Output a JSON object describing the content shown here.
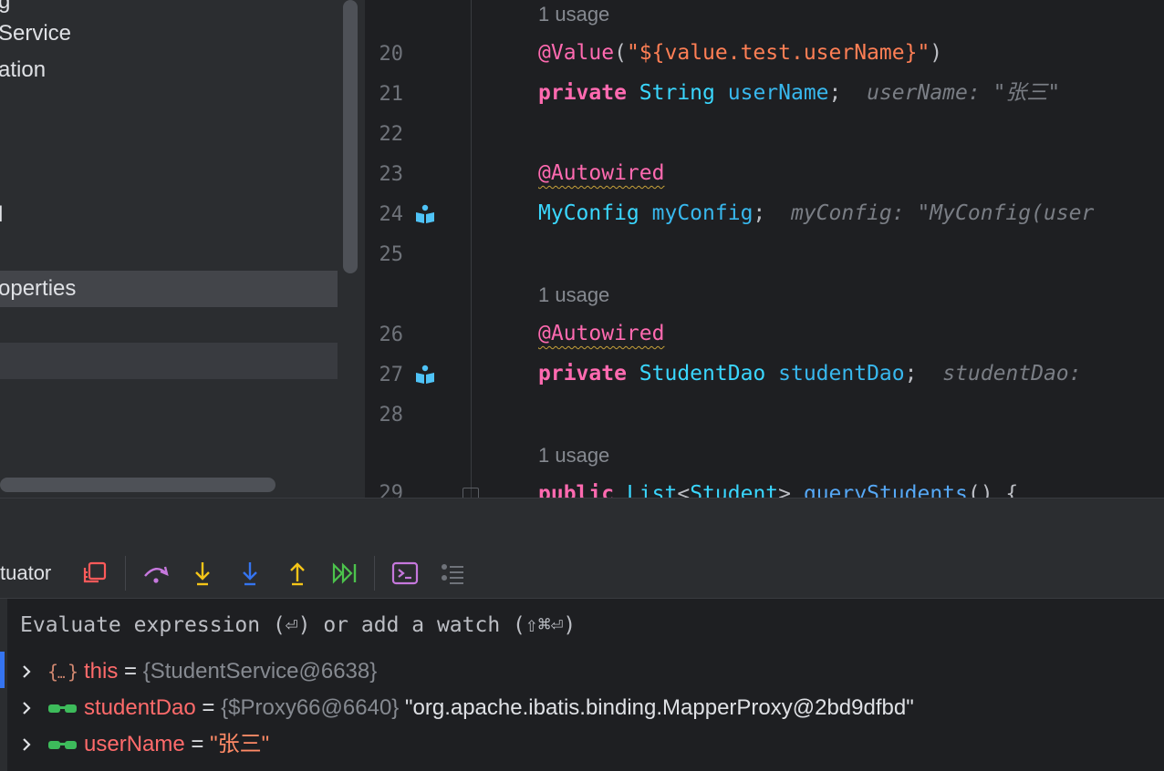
{
  "project_tree": {
    "rows": [
      {
        "text": "g",
        "state": "normal"
      },
      {
        "text": "Service",
        "state": "normal"
      },
      {
        "text": "ation",
        "state": "normal"
      },
      {
        "text": "l",
        "state": "normal"
      },
      {
        "text": "operties",
        "state": "selected"
      }
    ]
  },
  "editor": {
    "usage_hint": "1 usage",
    "line_numbers": {
      "l20": "20",
      "l21": "21",
      "l22": "22",
      "l23": "23",
      "l24": "24",
      "l25": "25",
      "l26": "26",
      "l27": "27",
      "l28": "28",
      "l29": "29"
    },
    "code": {
      "value_annotation": "@Value",
      "value_paren_open": "(",
      "value_string": "\"${value.test.userName}\"",
      "value_paren_close": ")",
      "kw_private": "private",
      "type_string": "String",
      "field_username": "userName",
      "semicolon": ";",
      "hint_username": "userName: \"张三\"",
      "autowired": "@Autowired",
      "type_myconfig": "MyConfig",
      "field_myconfig": "myConfig",
      "hint_myconfig": "myConfig: \"MyConfig(user",
      "type_studentdao": "StudentDao",
      "field_studentdao": "studentDao",
      "hint_studentdao": "studentDao:",
      "kw_public": "public",
      "type_list": "List",
      "generic_open": "<",
      "type_student": "Student",
      "generic_close": ">",
      "method_query": "queryStudents",
      "method_tail": "() {"
    },
    "gutter_icon": "bean-injection-icon"
  },
  "debugger": {
    "tab_label": "tuator",
    "toolbar_icons": [
      "restore-layout-icon",
      "step-over-icon",
      "step-into-icon",
      "force-step-into-icon",
      "step-out-icon",
      "run-to-cursor-icon",
      "evaluate-expression-icon",
      "threads-list-icon"
    ],
    "eval_placeholder": "Evaluate expression (⏎) or add a watch (⇧⌘⏎)",
    "variables": [
      {
        "icon": "object-icon",
        "name": "this",
        "equals": " = ",
        "address": "{StudentService@6638}",
        "value": ""
      },
      {
        "icon": "field-glasses-icon",
        "name": "studentDao",
        "equals": " = ",
        "address": "{$Proxy66@6640}",
        "value": " \"org.apache.ibatis.binding.MapperProxy@2bd9dfbd\""
      },
      {
        "icon": "field-glasses-icon",
        "name": "userName",
        "equals": " = ",
        "address": "",
        "value": "\"张三\""
      }
    ]
  },
  "colors": {
    "keyword": "#ff6ab0",
    "type": "#3ad7ff",
    "string": "#ff7f55",
    "accent": "#3574f0"
  }
}
